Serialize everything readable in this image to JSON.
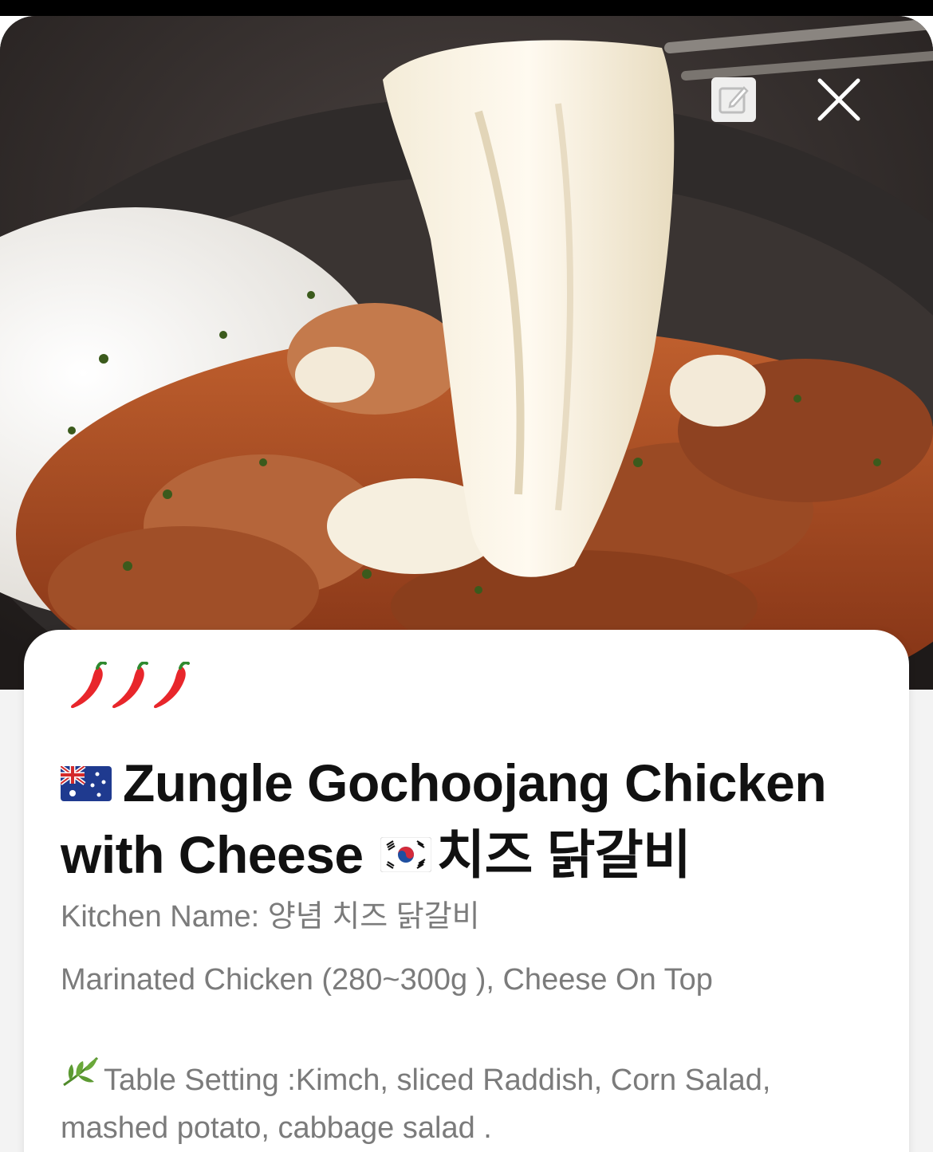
{
  "dish": {
    "spice_level": 3,
    "spice_icon": "chili-pepper-icon",
    "origin_flag": "australia-flag-icon",
    "title_main": "Zungle Gochoojang Chicken with Cheese",
    "korean_flag": "south-korea-flag-icon",
    "title_korean": "치즈 닭갈비",
    "kitchen_name": "Kitchen Name: 양념 치즈 닭갈비",
    "description": "Marinated Chicken (280~300g ), Cheese On Top",
    "table_setting_icon": "herb-leaf-icon",
    "table_setting": "Table Setting :Kimch, sliced Raddish, Corn Salad, mashed potato, cabbage salad ."
  },
  "actions": {
    "edit_icon": "edit-note-icon",
    "close_icon": "close-icon"
  },
  "colors": {
    "chili": "#e8262b",
    "title": "#111111",
    "secondary_text": "#7b7b7b",
    "card_bg": "#ffffff"
  }
}
